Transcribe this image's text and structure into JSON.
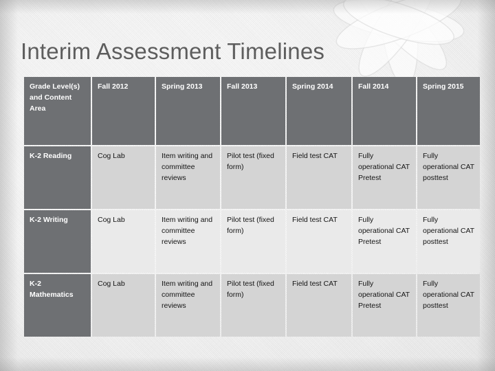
{
  "slide": {
    "title": "Interim Assessment Timelines",
    "title_color": "#5d5d5d",
    "background_color": "#f2f2f2",
    "header_fill": "#6e7073",
    "header_text_color": "#ffffff",
    "row_fill": "#d4d4d4",
    "row_alt_fill": "#eaeaea",
    "decoration": "flower-petal-watermark"
  },
  "table": {
    "headers": [
      "Grade Level(s) and Content Area",
      "Fall 2012",
      "Spring 2013",
      "Fall 2013",
      "Spring 2014",
      "Fall 2014",
      "Spring 2015"
    ],
    "rows": [
      {
        "label": "K-2 Reading",
        "cells": [
          "Cog Lab",
          "Item writing and committee reviews",
          "Pilot test (fixed form)",
          "Field test CAT",
          "Fully operational CAT Pretest",
          "Fully operational CAT posttest"
        ]
      },
      {
        "label": "K-2 Writing",
        "cells": [
          "Cog Lab",
          "Item writing and committee reviews",
          "Pilot test (fixed form)",
          "Field test CAT",
          "Fully operational CAT Pretest",
          "Fully operational CAT posttest"
        ]
      },
      {
        "label": "K-2 Mathematics",
        "cells": [
          "Cog Lab",
          "Item writing and committee reviews",
          "Pilot test (fixed form)",
          "Field test CAT",
          "Fully operational CAT Pretest",
          "Fully operational CAT posttest"
        ]
      }
    ]
  }
}
